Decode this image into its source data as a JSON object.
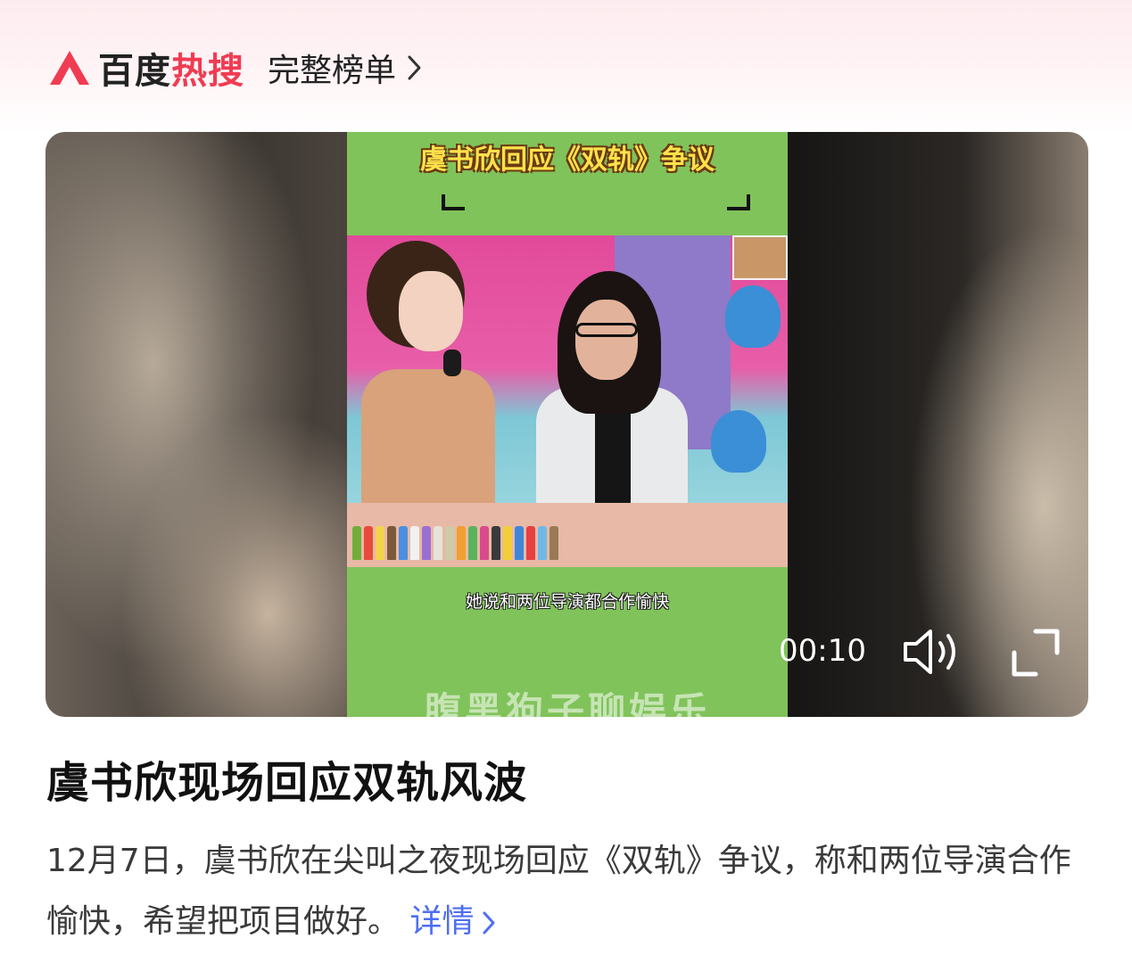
{
  "header": {
    "brand_regular": "百度",
    "brand_hot": "热搜",
    "full_ranking_label": "完整榜单",
    "logo_icon": "baidu-hot-search-logo",
    "chevron_icon": "chevron-right-icon"
  },
  "video": {
    "overlay_title": "虞书欣回应《双轨》争议",
    "subtitle": "她说和两位导演都合作愉快",
    "watermark": "腹黑狗子聊娱乐",
    "time": "00:10",
    "volume_icon": "volume-icon",
    "fullscreen_icon": "fullscreen-icon"
  },
  "article": {
    "headline": "虞书欣现场回应双轨风波",
    "description": "12月7日，虞书欣在尖叫之夜现场回应《双轨》争议，称和两位导演合作愉快，希望把项目做好。",
    "more_label": "详情"
  },
  "colors": {
    "brand_red": "#f03c52",
    "link_blue": "#4e6ef2",
    "video_green": "#80c35a"
  }
}
